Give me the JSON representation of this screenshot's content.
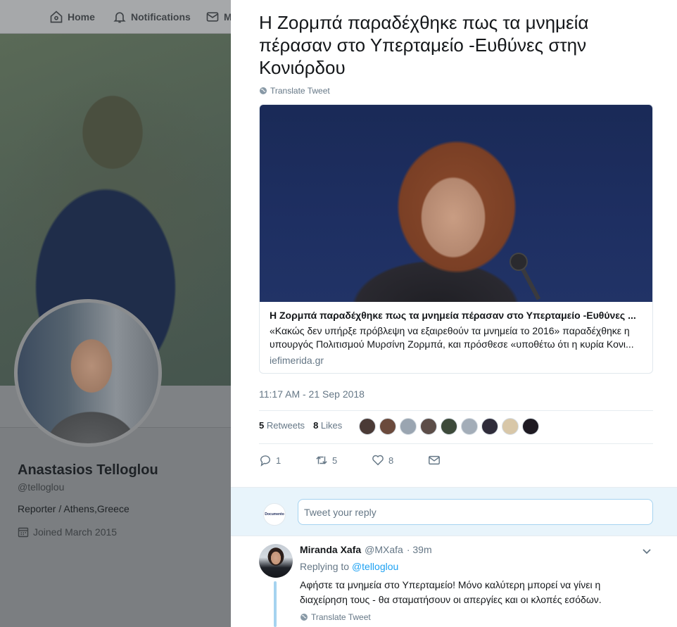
{
  "nav": {
    "home_label": "Home",
    "notifications_label": "Notifications",
    "messages_label": "M"
  },
  "profile": {
    "name": "Anastasios Telloglou",
    "handle": "@telloglou",
    "bio": "Reporter / Athens,Greece",
    "joined": "Joined March 2015"
  },
  "tweet": {
    "text": "Η Ζορμπά παραδέχθηκε πως τα μνημεία πέρασαν στο Υπερταμείο -Ευθύνες στην Κονιόρδου",
    "translate_label": "Translate Tweet",
    "card": {
      "title": "Η Ζορμπά παραδέχθηκε πως τα μνημεία πέρασαν στο Υπερταμείο -Ευθύνες ...",
      "description": "«Κακώς δεν υπήρξε πρόβλεψη να εξαιρεθούν τα μνημεία το 2016» παραδέχθηκε η υπουργός Πολιτισμού Μυρσίνη Ζορμπά, και πρόσθεσε «υποθέτω ότι η κυρία Κονι...",
      "domain": "iefimerida.gr"
    },
    "timestamp": "11:17 AM - 21 Sep 2018",
    "retweets_count": "5",
    "retweets_label": "Retweets",
    "likes_count": "8",
    "likes_label": "Likes",
    "liker_colors": [
      "#4a3a36",
      "#6b4a3c",
      "#9aa5b1",
      "#5c4d48",
      "#3d4a3a",
      "#a3adb8",
      "#2f2c3a",
      "#d8c7a8",
      "#1e1a22"
    ],
    "actions": {
      "reply_count": "1",
      "retweet_count": "5",
      "like_count": "8"
    }
  },
  "reply_box": {
    "placeholder": "Tweet your reply",
    "logo_text": "Documento"
  },
  "reply": {
    "author_name": "Miranda Xafa",
    "author_handle": "@MXafa",
    "time": "· 39m",
    "replying_prefix": "Replying to",
    "replying_to": "@telloglou",
    "text": "Αφήστε τα μνημεία στο Υπερταμείο! Μόνο καλύτερη μπορεί να γίνει η διαχείρηση τους - θα σταματήσουν οι απεργίες και οι κλοπές εσόδων.",
    "translate_label": "Translate Tweet"
  },
  "colors": {
    "accent": "#1da1f2",
    "muted_text": "#657786",
    "reply_thread_line": "#a5d3f0"
  }
}
